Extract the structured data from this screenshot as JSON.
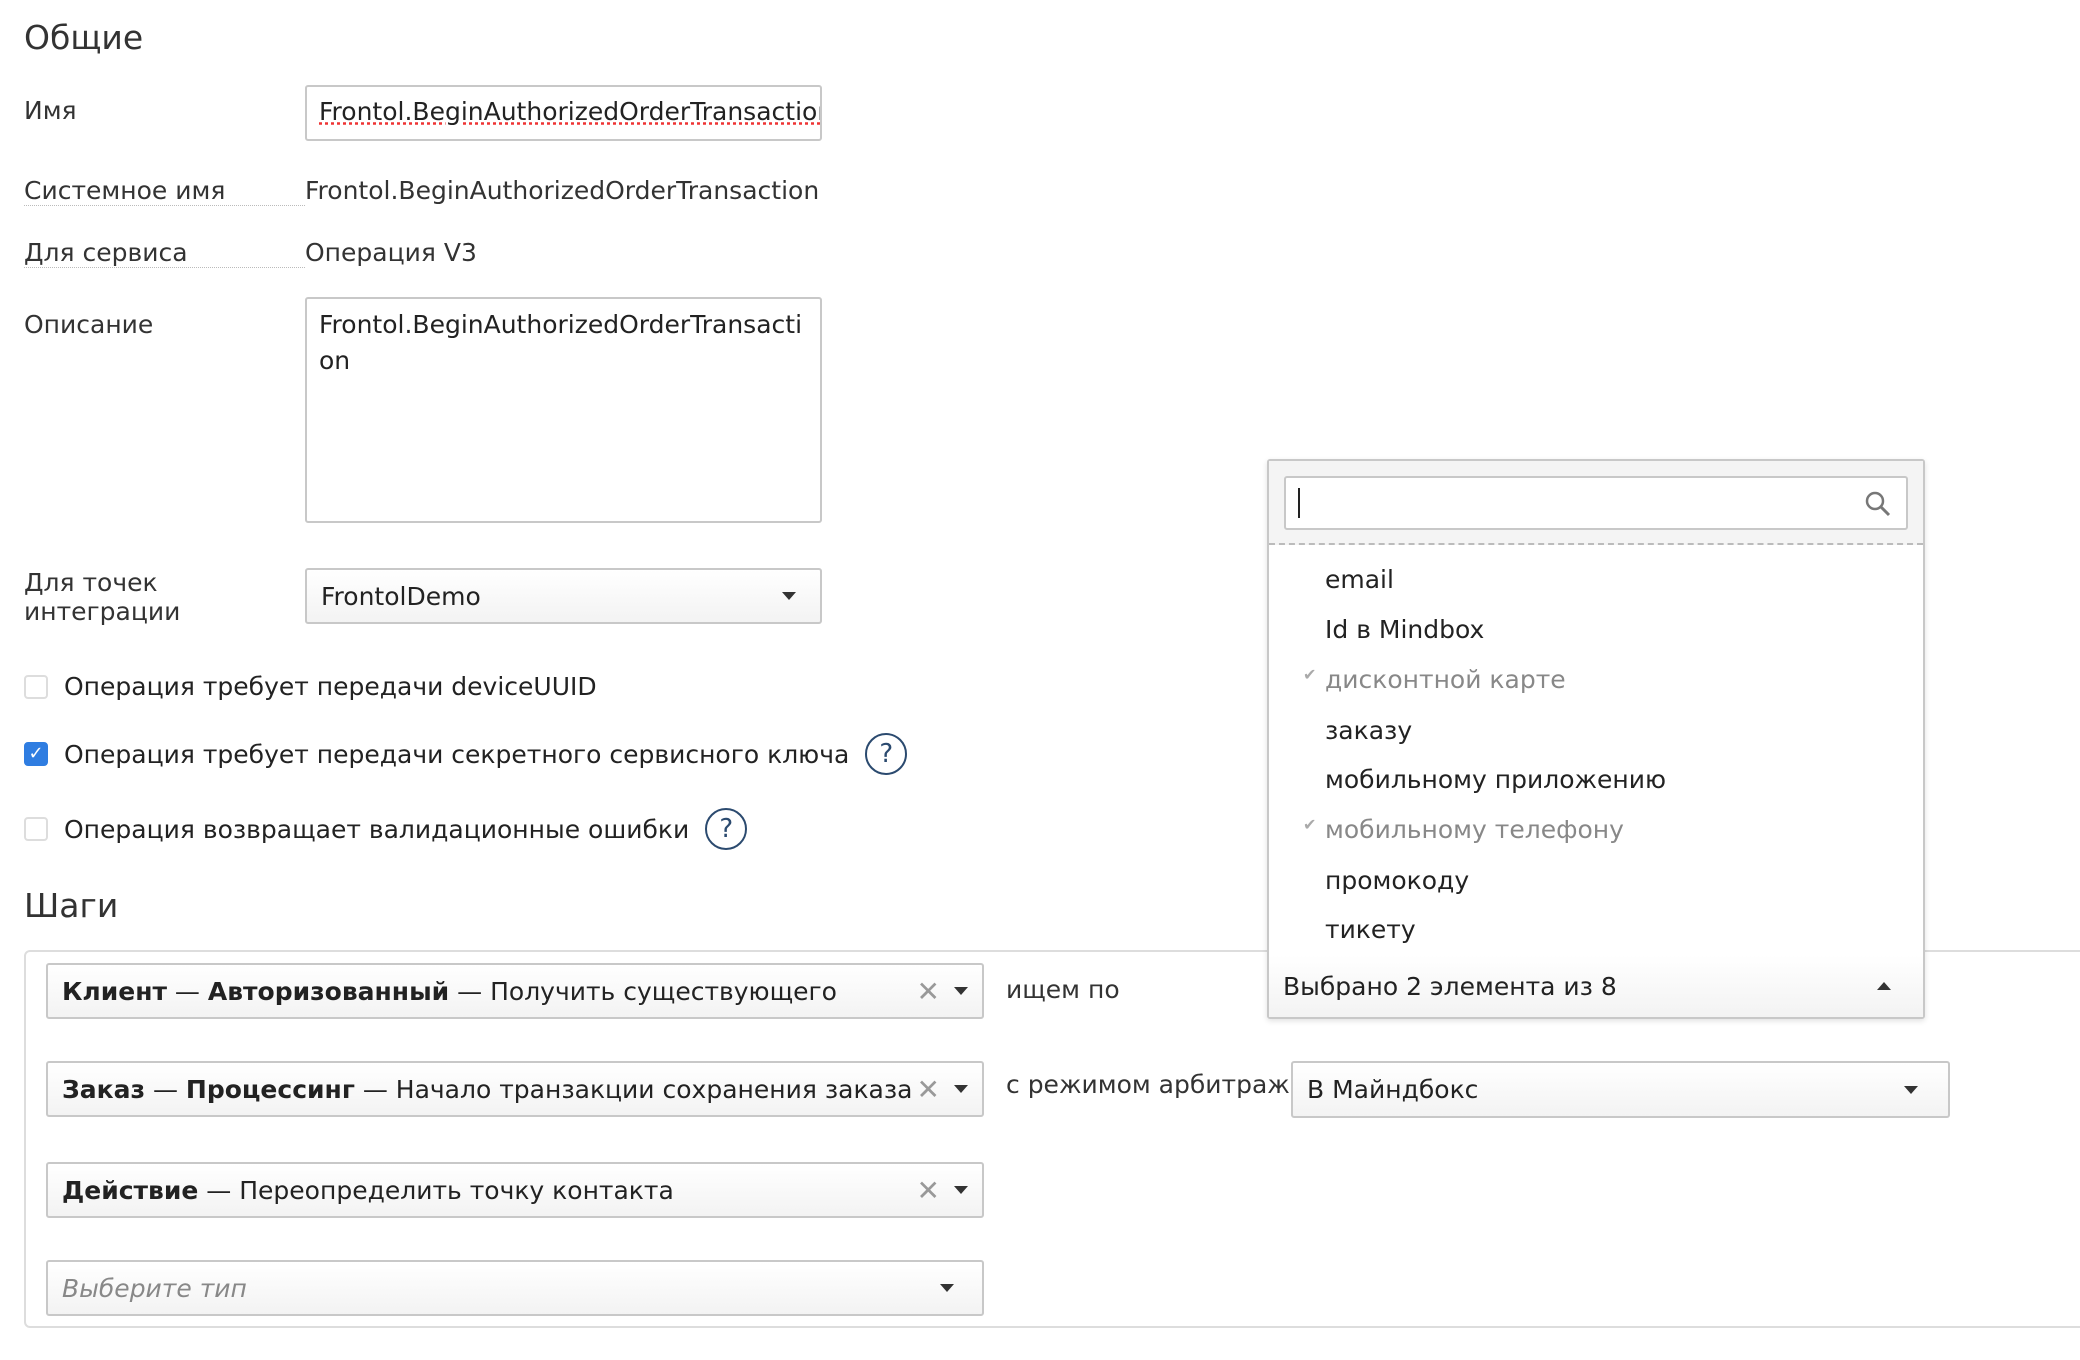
{
  "general": {
    "title": "Общие",
    "name_label": "Имя",
    "name_value": "Frontol.BeginAuthorizedOrderTransaction",
    "system_name_label": "Системное имя",
    "system_name_value": "Frontol.BeginAuthorizedOrderTransaction",
    "service_label": "Для сервиса",
    "service_value": "Операция V3",
    "description_label": "Описание",
    "description_value": "Frontol.BeginAuthorizedOrderTransaction",
    "integration_label": "Для точек интеграции",
    "integration_value": "FrontolDemo",
    "checkboxes": [
      {
        "label": "Операция требует передачи deviceUUID",
        "checked": false
      },
      {
        "label": "Операция требует передачи секретного сервисного ключа",
        "checked": true,
        "help": "?"
      },
      {
        "label": "Операция возвращает валидационные ошибки",
        "checked": false,
        "help": "?"
      }
    ]
  },
  "steps": {
    "title": "Шаги",
    "items": [
      {
        "bold1": "Клиент",
        "sep1": " — ",
        "bold2": "Авторизованный",
        "sep2": " — ",
        "text": "Получить существующего"
      },
      {
        "bold1": "Заказ",
        "sep1": " — ",
        "bold2": "Процессинг",
        "sep2": " — ",
        "text": "Начало транзакции сохранения заказа"
      },
      {
        "bold1": "Действие",
        "sep1": " — ",
        "text": "Переопределить точку контакта"
      }
    ],
    "new_step_placeholder": "Выберите тип",
    "search_by_label": "ищем по",
    "arbitration_label": "с режимом арбитража",
    "arbitration_value": "В Майндбокс"
  },
  "dropdown": {
    "search_value": "",
    "options": [
      {
        "label": "email",
        "selected": false
      },
      {
        "label": "Id в Mindbox",
        "selected": false
      },
      {
        "label": "дисконтной карте",
        "selected": true
      },
      {
        "label": "заказу",
        "selected": false
      },
      {
        "label": "мобильному приложению",
        "selected": false
      },
      {
        "label": "мобильному телефону",
        "selected": true
      },
      {
        "label": "промокоду",
        "selected": false
      },
      {
        "label": "тикету",
        "selected": false
      }
    ],
    "summary": "Выбрано 2 элемента из 8"
  },
  "colors": {
    "accent": "#2f7de1",
    "help": "#2b4a6f"
  }
}
